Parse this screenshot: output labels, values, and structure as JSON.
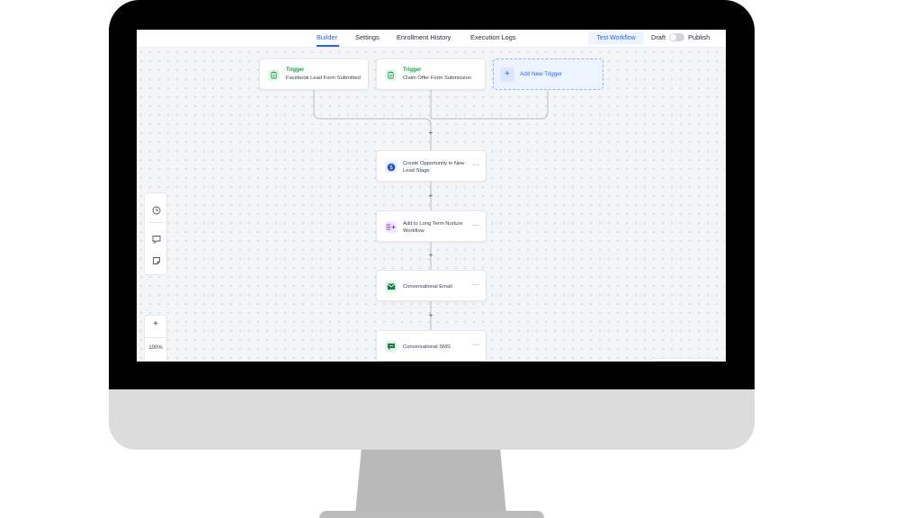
{
  "nav": {
    "tabs": [
      {
        "label": "Builder",
        "active": true
      },
      {
        "label": "Settings"
      },
      {
        "label": "Enrollment History"
      },
      {
        "label": "Execution Logs"
      }
    ],
    "test_label": "Test Workflow",
    "draft_label": "Draft",
    "publish_label": "Publish",
    "publish_toggle_on": false
  },
  "triggers": [
    {
      "title": "Trigger",
      "subtitle": "Facebook Lead Form Submitted",
      "icon": "clipboard-icon"
    },
    {
      "title": "Trigger",
      "subtitle": "Claim Offer Form Submission",
      "icon": "clipboard-icon"
    }
  ],
  "add_trigger": {
    "label": "Add New Trigger",
    "icon": "plus-icon"
  },
  "actions": [
    {
      "label": "Create Opportunity in New Lead Stage",
      "icon": "dollar-icon",
      "more": "···"
    },
    {
      "label": "Add to Long Term Nurture Workflow",
      "icon": "workflow-add-icon",
      "more": "···"
    },
    {
      "label": "Conversational Email",
      "icon": "email-icon",
      "more": "···"
    },
    {
      "label": "Conversational SMS",
      "icon": "sms-icon",
      "more": "···"
    }
  ],
  "add_step_symbol": "+",
  "zoom": {
    "plus": "+",
    "level": "100%"
  },
  "tools": [
    "history-icon",
    "comment-icon",
    "sticky-note-icon"
  ],
  "colors": {
    "accent": "#2563eb",
    "trigger_green": "#16a34a",
    "canvas": "#f4f5f7",
    "bezel": "#000000",
    "chin": "#dcdcdc"
  }
}
